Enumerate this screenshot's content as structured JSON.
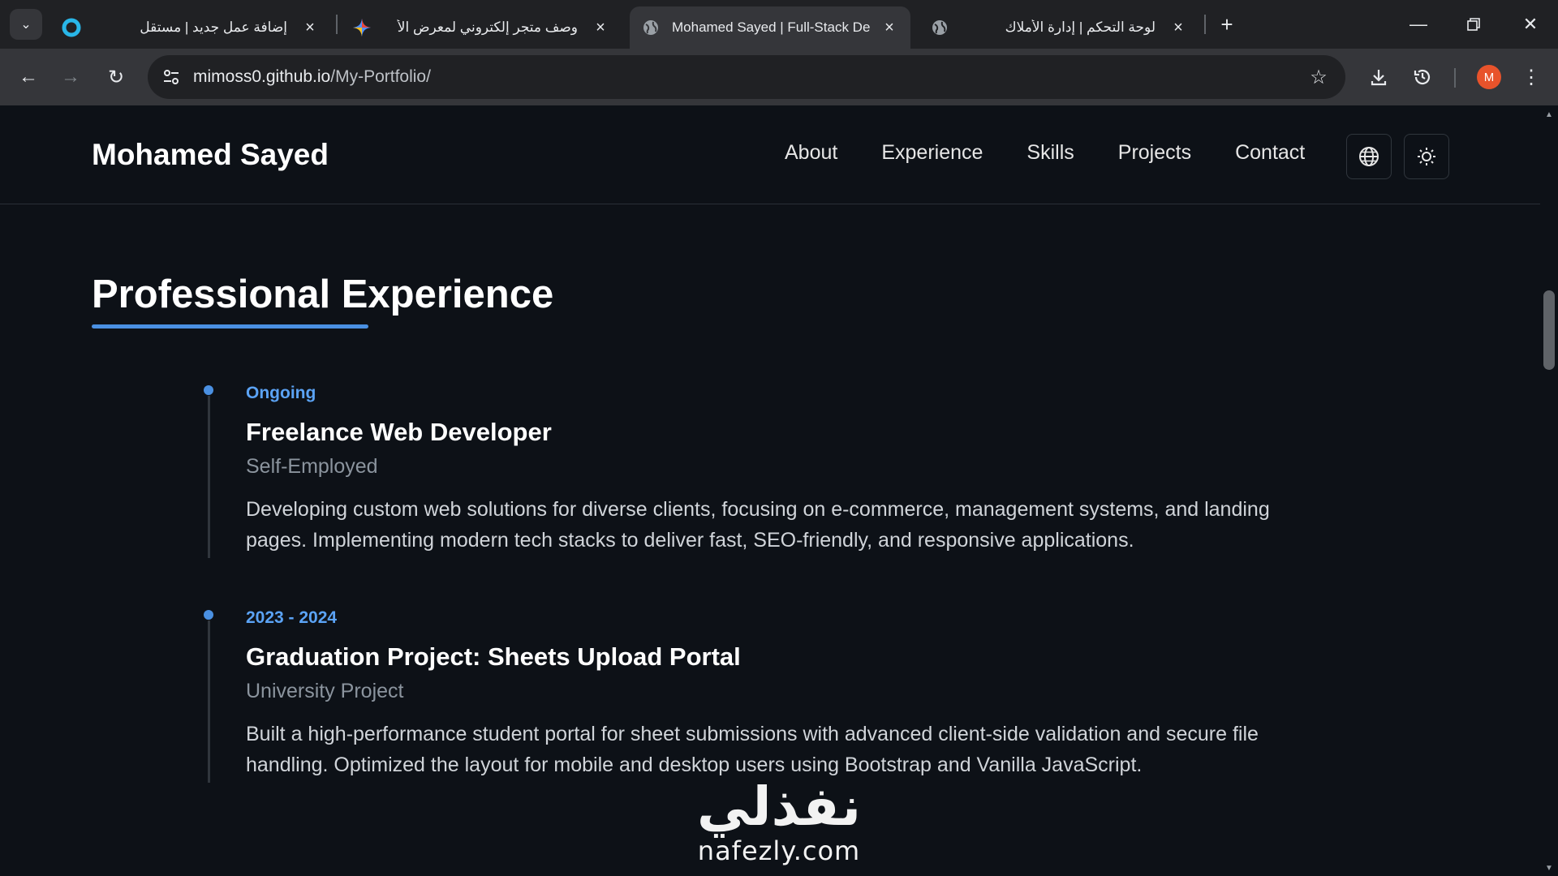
{
  "browser": {
    "tabs": [
      {
        "title": "إضافة عمل جديد | مستقل",
        "favicon": "mostaql-icon",
        "active": false
      },
      {
        "title": "وصف متجر إلكتروني لمعرض الأ",
        "favicon": "gemini-icon",
        "active": false
      },
      {
        "title": "Mohamed Sayed | Full-Stack De",
        "favicon": "globe-icon",
        "active": true
      },
      {
        "title": "لوحة التحكم | إدارة الأملاك",
        "favicon": "globe-icon",
        "active": false
      }
    ],
    "url_host": "mimoss0.github.io",
    "url_path": "/My-Portfolio/",
    "profile_initial": "M",
    "profile_color": "#e8532b"
  },
  "site": {
    "brand": "Mohamed Sayed",
    "nav": [
      "About",
      "Experience",
      "Skills",
      "Projects",
      "Contact"
    ],
    "language_icon": "globe-icon",
    "theme_icon": "sun-icon"
  },
  "experience": {
    "title": "Professional Experience",
    "accent_color": "#4a90e2",
    "items": [
      {
        "date": "Ongoing",
        "title": "Freelance Web Developer",
        "org": "Self-Employed",
        "desc": "Developing custom web solutions for diverse clients, focusing on e-commerce, management systems, and landing pages. Implementing modern tech stacks to deliver fast, SEO-friendly, and responsive applications."
      },
      {
        "date": "2023 - 2024",
        "title": "Graduation Project: Sheets Upload Portal",
        "org": "University Project",
        "desc": "Built a high-performance student portal for sheet submissions with advanced client-side validation and secure file handling. Optimized the layout for mobile and desktop users using Bootstrap and Vanilla JavaScript."
      }
    ]
  },
  "watermark": {
    "arabic": "نفذلي",
    "latin": "nafezly.com"
  }
}
